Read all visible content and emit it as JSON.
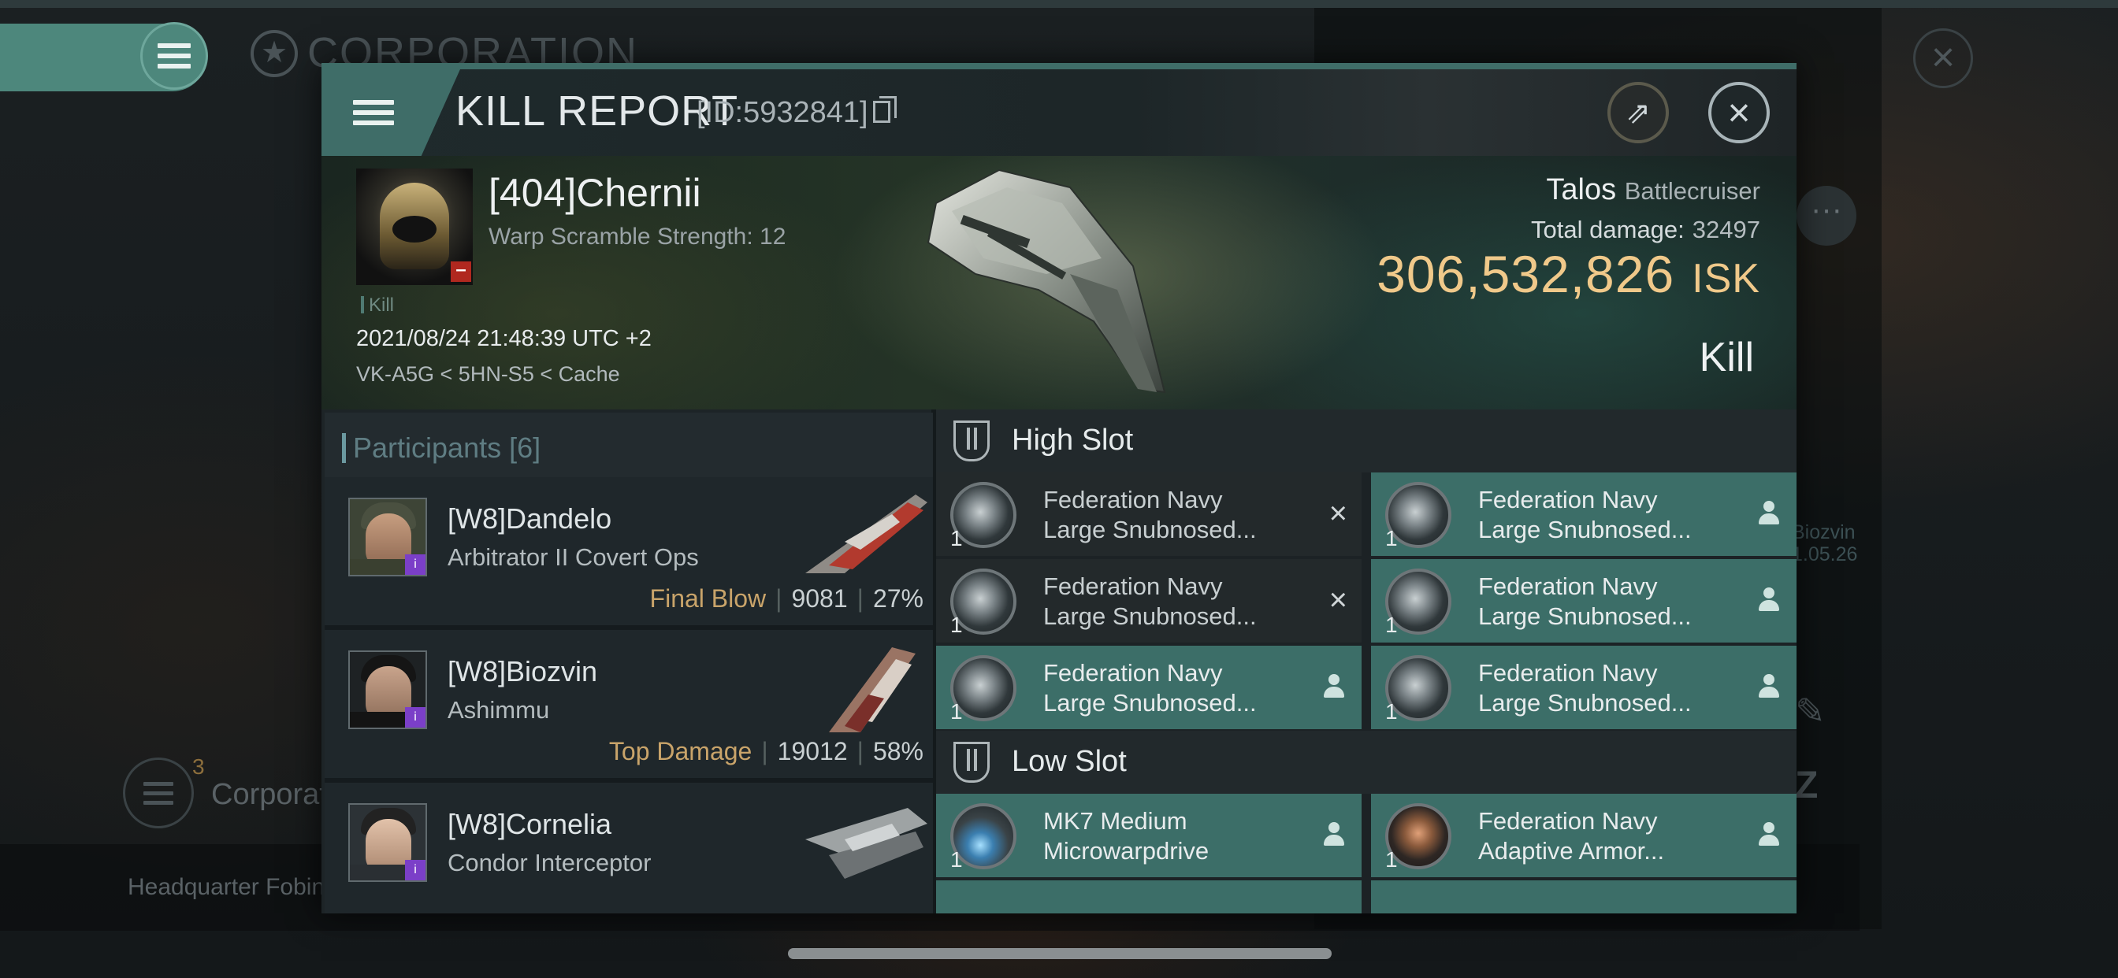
{
  "background": {
    "corp_title": "CORPORATION",
    "corp_badge_count": "3",
    "corp_label": "Corporati",
    "hq_label": "Headquarter Fobin",
    "side_name": "Biozvin",
    "side_date": "1.05.26"
  },
  "header": {
    "title": "KILL REPORT",
    "report_id": "[ID:5932841]"
  },
  "victim": {
    "name": "[404]Chernii",
    "subtitle": "Warp Scramble Strength: 12",
    "tag": "Kill",
    "datetime": "2021/08/24 21:48:39 UTC +2",
    "location": "VK-A5G < 5HN-S5 < Cache"
  },
  "ship": {
    "name": "Talos",
    "class": "Battlecruiser",
    "total_damage_label": "Total damage:",
    "total_damage": "32497",
    "isk_value": "306,532,826",
    "isk_unit": "ISK",
    "result": "Kill"
  },
  "participants": {
    "title": "Participants",
    "count": "[6]",
    "items": [
      {
        "name": "[W8]Dandelo",
        "ship": "Arbitrator II Covert Ops",
        "label": "Final Blow",
        "damage": "9081",
        "percent": "27%"
      },
      {
        "name": "[W8]Biozvin",
        "ship": "Ashimmu",
        "label": "Top Damage",
        "damage": "19012",
        "percent": "58%"
      },
      {
        "name": "[W8]Cornelia",
        "ship": "Condor Interceptor",
        "label": "",
        "damage": "",
        "percent": ""
      }
    ]
  },
  "fitting": {
    "high_slot_label": "High Slot",
    "low_slot_label": "Low Slot",
    "high_slot": [
      {
        "line1": "Federation Navy",
        "line2": "Large Snubnosed...",
        "qty": "1",
        "state": "destroyed",
        "icon": "railgun-icon"
      },
      {
        "line1": "Federation Navy",
        "line2": "Large Snubnosed...",
        "qty": "1",
        "state": "dropped",
        "icon": "railgun-icon"
      },
      {
        "line1": "Federation Navy",
        "line2": "Large Snubnosed...",
        "qty": "1",
        "state": "destroyed",
        "icon": "railgun-icon"
      },
      {
        "line1": "Federation Navy",
        "line2": "Large Snubnosed...",
        "qty": "1",
        "state": "dropped",
        "icon": "railgun-icon"
      },
      {
        "line1": "Federation Navy",
        "line2": "Large Snubnosed...",
        "qty": "1",
        "state": "dropped",
        "icon": "railgun-icon"
      },
      {
        "line1": "Federation Navy",
        "line2": "Large Snubnosed...",
        "qty": "1",
        "state": "dropped",
        "icon": "railgun-icon"
      }
    ],
    "low_slot": [
      {
        "line1": "MK7 Medium",
        "line2": "Microwarpdrive",
        "qty": "1",
        "state": "dropped",
        "icon": "microwarpdrive-icon"
      },
      {
        "line1": "Federation Navy",
        "line2": "Adaptive Armor...",
        "qty": "1",
        "state": "dropped",
        "icon": "armor-hardener-icon"
      }
    ]
  },
  "colors": {
    "accent_teal": "#3c6e68",
    "isk_gold": "#f0c98a",
    "label_gold": "#c9a46a"
  }
}
